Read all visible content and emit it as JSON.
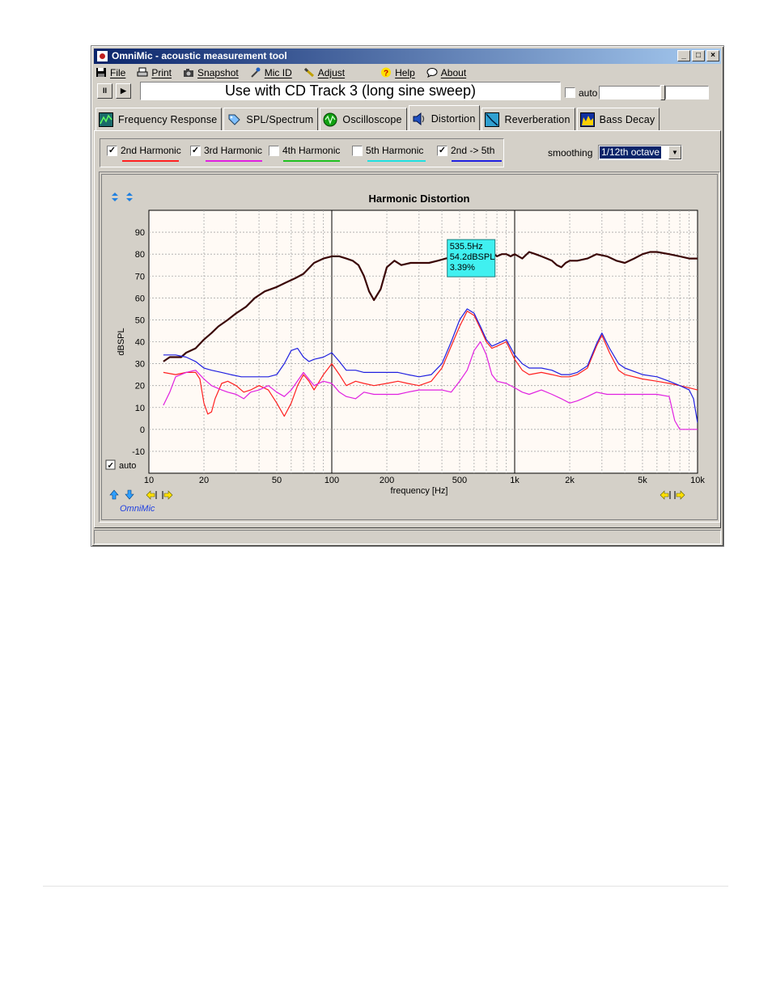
{
  "window": {
    "title": "OmniMic - acoustic measurement tool",
    "min_btn": "_",
    "max_btn": "□",
    "close_btn": "×"
  },
  "menu": [
    {
      "id": "file",
      "label": "File",
      "icon": "floppy-icon"
    },
    {
      "id": "print",
      "label": "Print",
      "icon": "printer-icon"
    },
    {
      "id": "snapshot",
      "label": "Snapshot",
      "icon": "camera-icon"
    },
    {
      "id": "mic-id",
      "label": "Mic ID",
      "icon": "microphone-icon"
    },
    {
      "id": "adjust",
      "label": "Adjust",
      "icon": "wrench-icon"
    },
    {
      "id": "help",
      "label": "Help",
      "icon": "help-icon"
    },
    {
      "id": "about",
      "label": "About",
      "icon": "speech-bubble-icon"
    }
  ],
  "toolbar": {
    "pause_glyph": "II",
    "play_glyph": "▶",
    "track_text": "Use with CD Track 3 (long sine sweep)",
    "auto_label": "auto"
  },
  "tabs": [
    {
      "label": "Frequency Response",
      "icon": "frequency-response-icon"
    },
    {
      "label": "SPL/Spectrum",
      "icon": "spl-tag-icon"
    },
    {
      "label": "Oscilloscope",
      "icon": "oscilloscope-icon"
    },
    {
      "label": "Distortion",
      "icon": "distortion-speaker-icon",
      "active": true
    },
    {
      "label": "Reverberation",
      "icon": "reverberation-icon"
    },
    {
      "label": "Bass Decay",
      "icon": "bass-decay-icon"
    }
  ],
  "harmonics": [
    {
      "label": "2nd Harmonic",
      "checked": true,
      "color": "#ff2020"
    },
    {
      "label": "3rd Harmonic",
      "checked": true,
      "color": "#e020e0"
    },
    {
      "label": "4th Harmonic",
      "checked": false,
      "color": "#20c020"
    },
    {
      "label": "5th Harmonic",
      "checked": false,
      "color": "#20e0e0"
    },
    {
      "label": "2nd -> 5th",
      "checked": true,
      "color": "#2020e0"
    }
  ],
  "check_mark": "✓",
  "smoothing": {
    "label": "smoothing",
    "value": "1/12th octave",
    "arrow": "▼"
  },
  "plot_controls": {
    "auto_label": "auto",
    "auto_checked": true,
    "brand": "OmniMic"
  },
  "chart_data": {
    "type": "line",
    "title": "Harmonic Distortion",
    "xlabel": "frequency [Hz]",
    "ylabel": "dBSPL",
    "x_scale": "log",
    "xlim": [
      10,
      10000
    ],
    "ylim": [
      -20,
      100
    ],
    "grid": true,
    "x_ticks": [
      {
        "v": 10,
        "label": "10"
      },
      {
        "v": 20,
        "label": "20"
      },
      {
        "v": 50,
        "label": "50"
      },
      {
        "v": 100,
        "label": "100"
      },
      {
        "v": 200,
        "label": "200"
      },
      {
        "v": 500,
        "label": "500"
      },
      {
        "v": 1000,
        "label": "1k"
      },
      {
        "v": 2000,
        "label": "2k"
      },
      {
        "v": 5000,
        "label": "5k"
      },
      {
        "v": 10000,
        "label": "10k"
      }
    ],
    "y_ticks": [
      -10,
      0,
      10,
      20,
      30,
      40,
      50,
      60,
      70,
      80,
      90
    ],
    "colors": {
      "background": "#fffaf5",
      "grid": "#a8a8a8",
      "decade": "#000000"
    },
    "cursor": {
      "freq": "535.5Hz",
      "level": "54.2dBSPL",
      "percent": "3.39%"
    },
    "series": [
      {
        "color": "#3a0606",
        "width": 2.2,
        "points": [
          [
            12,
            31
          ],
          [
            13,
            33
          ],
          [
            15,
            33
          ],
          [
            16,
            35
          ],
          [
            18,
            37
          ],
          [
            20,
            41
          ],
          [
            22,
            44
          ],
          [
            24,
            47
          ],
          [
            27,
            50
          ],
          [
            30,
            53
          ],
          [
            34,
            56
          ],
          [
            38,
            60
          ],
          [
            43,
            63
          ],
          [
            50,
            65
          ],
          [
            56,
            67
          ],
          [
            63,
            69
          ],
          [
            70,
            71
          ],
          [
            80,
            76
          ],
          [
            90,
            78
          ],
          [
            100,
            79
          ],
          [
            110,
            79
          ],
          [
            120,
            78
          ],
          [
            130,
            77
          ],
          [
            140,
            75
          ],
          [
            150,
            70
          ],
          [
            160,
            63
          ],
          [
            170,
            59
          ],
          [
            185,
            64
          ],
          [
            200,
            74
          ],
          [
            220,
            77
          ],
          [
            240,
            75
          ],
          [
            270,
            76
          ],
          [
            300,
            76
          ],
          [
            340,
            76
          ],
          [
            380,
            77
          ],
          [
            420,
            78
          ],
          [
            470,
            79
          ],
          [
            520,
            80
          ],
          [
            560,
            79
          ],
          [
            600,
            81
          ],
          [
            650,
            79
          ],
          [
            700,
            80
          ],
          [
            750,
            81
          ],
          [
            800,
            79
          ],
          [
            850,
            80
          ],
          [
            900,
            80
          ],
          [
            950,
            79
          ],
          [
            1000,
            80
          ],
          [
            1100,
            78
          ],
          [
            1200,
            81
          ],
          [
            1300,
            80
          ],
          [
            1400,
            79
          ],
          [
            1500,
            78
          ],
          [
            1600,
            77
          ],
          [
            1700,
            75
          ],
          [
            1800,
            74
          ],
          [
            1900,
            76
          ],
          [
            2000,
            77
          ],
          [
            2200,
            77
          ],
          [
            2500,
            78
          ],
          [
            2800,
            80
          ],
          [
            3200,
            79
          ],
          [
            3600,
            77
          ],
          [
            4000,
            76
          ],
          [
            4500,
            78
          ],
          [
            5000,
            80
          ],
          [
            5500,
            81
          ],
          [
            6000,
            81
          ],
          [
            7000,
            80
          ],
          [
            8000,
            79
          ],
          [
            9000,
            78
          ],
          [
            10000,
            78
          ]
        ]
      },
      {
        "name": "2nd Harmonic",
        "color": "#ff2020",
        "width": 1.2,
        "points": [
          [
            12,
            26
          ],
          [
            14,
            25
          ],
          [
            16,
            26
          ],
          [
            18,
            26
          ],
          [
            19,
            23
          ],
          [
            20,
            12
          ],
          [
            21,
            7
          ],
          [
            22,
            8
          ],
          [
            23,
            14
          ],
          [
            25,
            21
          ],
          [
            27,
            22
          ],
          [
            30,
            20
          ],
          [
            33,
            17
          ],
          [
            36,
            18
          ],
          [
            40,
            20
          ],
          [
            45,
            18
          ],
          [
            50,
            12
          ],
          [
            55,
            6
          ],
          [
            60,
            12
          ],
          [
            65,
            20
          ],
          [
            70,
            25
          ],
          [
            75,
            22
          ],
          [
            80,
            18
          ],
          [
            90,
            25
          ],
          [
            100,
            30
          ],
          [
            110,
            25
          ],
          [
            120,
            20
          ],
          [
            135,
            22
          ],
          [
            150,
            21
          ],
          [
            170,
            20
          ],
          [
            200,
            21
          ],
          [
            230,
            22
          ],
          [
            260,
            21
          ],
          [
            300,
            20
          ],
          [
            350,
            22
          ],
          [
            400,
            28
          ],
          [
            450,
            38
          ],
          [
            500,
            47
          ],
          [
            550,
            54
          ],
          [
            600,
            52
          ],
          [
            650,
            46
          ],
          [
            700,
            40
          ],
          [
            750,
            37
          ],
          [
            800,
            38
          ],
          [
            900,
            40
          ],
          [
            1000,
            32
          ],
          [
            1100,
            27
          ],
          [
            1200,
            25
          ],
          [
            1400,
            26
          ],
          [
            1600,
            25
          ],
          [
            1800,
            24
          ],
          [
            2000,
            24
          ],
          [
            2200,
            25
          ],
          [
            2500,
            28
          ],
          [
            2800,
            38
          ],
          [
            3000,
            43
          ],
          [
            3300,
            35
          ],
          [
            3700,
            27
          ],
          [
            4000,
            25
          ],
          [
            5000,
            23
          ],
          [
            6000,
            22
          ],
          [
            7000,
            21
          ],
          [
            8000,
            20
          ],
          [
            9000,
            19
          ],
          [
            10000,
            18
          ]
        ]
      },
      {
        "name": "3rd Harmonic",
        "color": "#e020e0",
        "width": 1.2,
        "points": [
          [
            12,
            11
          ],
          [
            13,
            17
          ],
          [
            14,
            24
          ],
          [
            16,
            26
          ],
          [
            18,
            27
          ],
          [
            20,
            23
          ],
          [
            22,
            20
          ],
          [
            25,
            18
          ],
          [
            27,
            17
          ],
          [
            30,
            16
          ],
          [
            33,
            14
          ],
          [
            36,
            17
          ],
          [
            40,
            18
          ],
          [
            45,
            20
          ],
          [
            50,
            17
          ],
          [
            55,
            15
          ],
          [
            60,
            18
          ],
          [
            70,
            26
          ],
          [
            80,
            20
          ],
          [
            90,
            22
          ],
          [
            100,
            21
          ],
          [
            110,
            17
          ],
          [
            120,
            15
          ],
          [
            135,
            14
          ],
          [
            150,
            17
          ],
          [
            170,
            16
          ],
          [
            200,
            16
          ],
          [
            230,
            16
          ],
          [
            260,
            17
          ],
          [
            300,
            18
          ],
          [
            350,
            18
          ],
          [
            400,
            18
          ],
          [
            450,
            17
          ],
          [
            500,
            22
          ],
          [
            550,
            27
          ],
          [
            600,
            36
          ],
          [
            650,
            40
          ],
          [
            700,
            34
          ],
          [
            750,
            25
          ],
          [
            800,
            22
          ],
          [
            900,
            21
          ],
          [
            1000,
            19
          ],
          [
            1100,
            17
          ],
          [
            1200,
            16
          ],
          [
            1400,
            18
          ],
          [
            1600,
            16
          ],
          [
            1800,
            14
          ],
          [
            2000,
            12
          ],
          [
            2200,
            13
          ],
          [
            2500,
            15
          ],
          [
            2800,
            17
          ],
          [
            3200,
            16
          ],
          [
            3600,
            16
          ],
          [
            4000,
            16
          ],
          [
            5000,
            16
          ],
          [
            6000,
            16
          ],
          [
            7000,
            15
          ],
          [
            7500,
            4
          ],
          [
            8000,
            0
          ],
          [
            9000,
            0
          ],
          [
            10000,
            0
          ]
        ]
      },
      {
        "name": "2nd -> 5th",
        "color": "#2020e0",
        "width": 1.2,
        "points": [
          [
            12,
            34
          ],
          [
            14,
            34
          ],
          [
            16,
            33
          ],
          [
            18,
            31
          ],
          [
            20,
            28
          ],
          [
            22,
            27
          ],
          [
            25,
            26
          ],
          [
            28,
            25
          ],
          [
            32,
            24
          ],
          [
            36,
            24
          ],
          [
            40,
            24
          ],
          [
            45,
            24
          ],
          [
            50,
            25
          ],
          [
            55,
            30
          ],
          [
            60,
            36
          ],
          [
            65,
            37
          ],
          [
            70,
            33
          ],
          [
            75,
            31
          ],
          [
            80,
            32
          ],
          [
            90,
            33
          ],
          [
            100,
            35
          ],
          [
            110,
            31
          ],
          [
            120,
            27
          ],
          [
            135,
            27
          ],
          [
            150,
            26
          ],
          [
            170,
            26
          ],
          [
            200,
            26
          ],
          [
            230,
            26
          ],
          [
            260,
            25
          ],
          [
            300,
            24
          ],
          [
            350,
            25
          ],
          [
            400,
            30
          ],
          [
            450,
            40
          ],
          [
            500,
            50
          ],
          [
            550,
            55
          ],
          [
            600,
            53
          ],
          [
            650,
            47
          ],
          [
            700,
            41
          ],
          [
            750,
            38
          ],
          [
            800,
            39
          ],
          [
            900,
            41
          ],
          [
            1000,
            34
          ],
          [
            1100,
            30
          ],
          [
            1200,
            28
          ],
          [
            1400,
            28
          ],
          [
            1600,
            27
          ],
          [
            1800,
            25
          ],
          [
            2000,
            25
          ],
          [
            2200,
            26
          ],
          [
            2500,
            29
          ],
          [
            2800,
            39
          ],
          [
            3000,
            44
          ],
          [
            3300,
            37
          ],
          [
            3700,
            30
          ],
          [
            4000,
            28
          ],
          [
            5000,
            25
          ],
          [
            6000,
            24
          ],
          [
            7000,
            22
          ],
          [
            8000,
            20
          ],
          [
            9000,
            18
          ],
          [
            9500,
            14
          ],
          [
            10000,
            3
          ]
        ]
      }
    ]
  }
}
